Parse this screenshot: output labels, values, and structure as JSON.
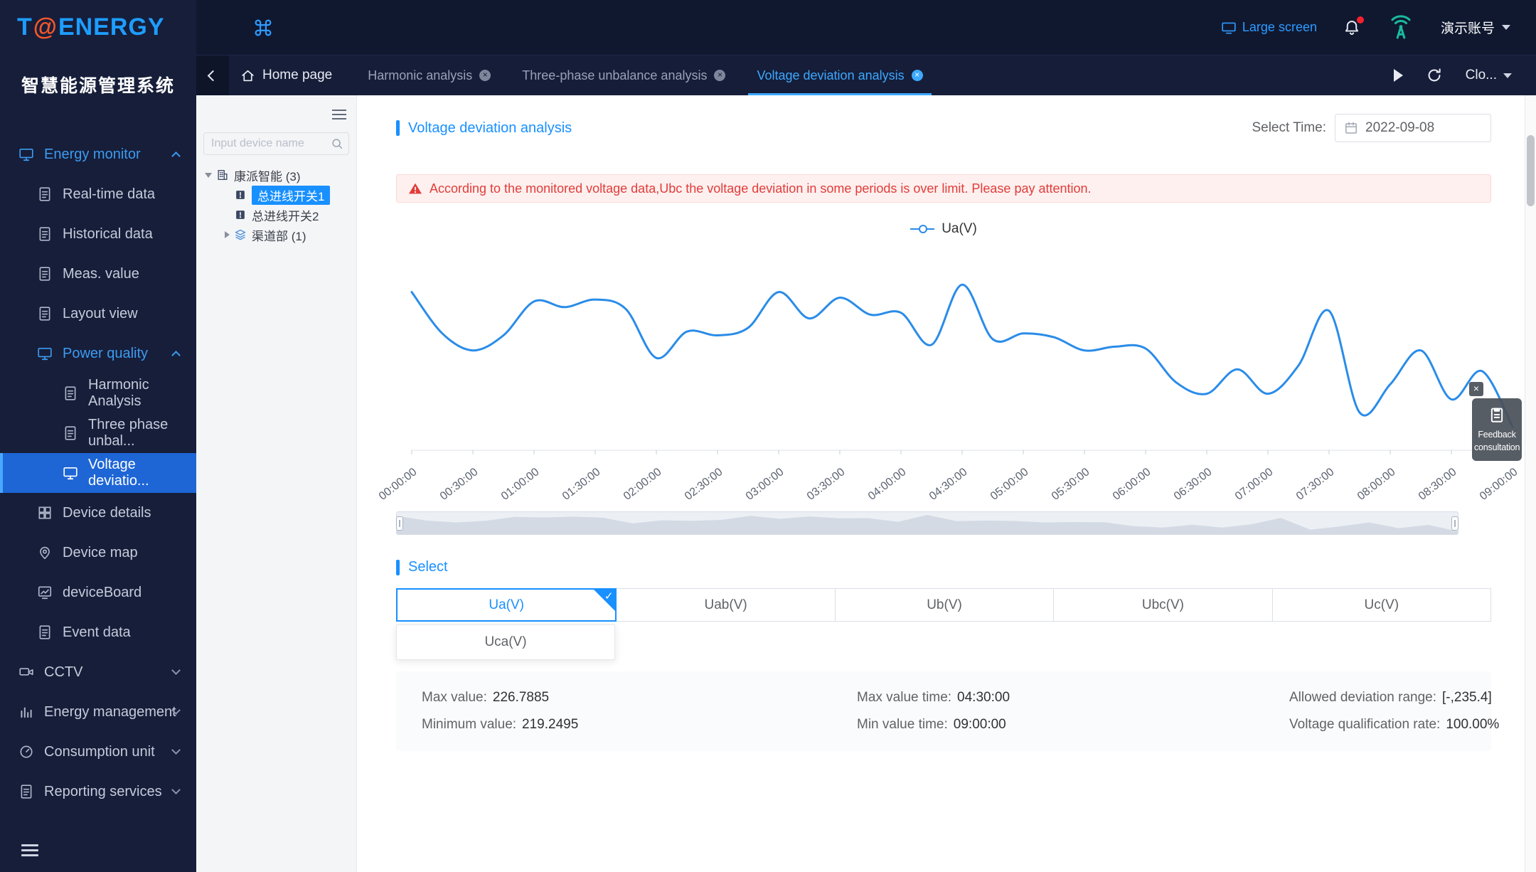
{
  "brand": {
    "logo_t": "T",
    "logo_at": "@",
    "logo_rest": "ENERGY",
    "system_title": "智慧能源管理系统"
  },
  "topbar": {
    "large_screen_label": "Large screen",
    "account_label": "演示账号"
  },
  "tabbar": {
    "home_label": "Home page",
    "tabs": [
      {
        "label": "Harmonic analysis",
        "active": false
      },
      {
        "label": "Three-phase unbalance analysis",
        "active": false
      },
      {
        "label": "Voltage deviation analysis",
        "active": true
      }
    ],
    "close_glyph": "×",
    "close_dropdown_label": "Clo..."
  },
  "sidebar": {
    "menu": [
      {
        "label": "Energy monitor",
        "level": 0,
        "icon": "monitor",
        "color": "blue",
        "chevron": "up"
      },
      {
        "label": "Real-time data",
        "level": 1,
        "icon": "doc"
      },
      {
        "label": "Historical data",
        "level": 1,
        "icon": "doc"
      },
      {
        "label": "Meas. value",
        "level": 1,
        "icon": "doc"
      },
      {
        "label": "Layout view",
        "level": 1,
        "icon": "doc"
      },
      {
        "label": "Power quality",
        "level": 1,
        "icon": "monitor",
        "color": "blue",
        "chevron": "up"
      },
      {
        "label": "Harmonic Analysis",
        "level": 2,
        "icon": "doc"
      },
      {
        "label": "Three phase unbal...",
        "level": 2,
        "icon": "doc"
      },
      {
        "label": "Voltage deviatio...",
        "level": 2,
        "icon": "monitor",
        "active": true
      },
      {
        "label": "Device details",
        "level": 1,
        "icon": "grid"
      },
      {
        "label": "Device map",
        "level": 1,
        "icon": "pin"
      },
      {
        "label": "deviceBoard",
        "level": 1,
        "icon": "board"
      },
      {
        "label": "Event data",
        "level": 1,
        "icon": "doc"
      },
      {
        "label": "CCTV",
        "level": 0,
        "icon": "camera",
        "chevron": "down"
      },
      {
        "label": "Energy management",
        "level": 0,
        "icon": "chart",
        "chevron": "down"
      },
      {
        "label": "Consumption unit",
        "level": 0,
        "icon": "gauge",
        "chevron": "down"
      },
      {
        "label": "Reporting services",
        "level": 0,
        "icon": "doc",
        "chevron": "down"
      }
    ]
  },
  "device_panel": {
    "search_placeholder": "Input device name",
    "tree": [
      {
        "label": "康派智能 (3)",
        "level": 0,
        "icon": "building",
        "caret": "exp"
      },
      {
        "label": "总进线开关1",
        "level": 1,
        "icon": "breaker",
        "selected": true
      },
      {
        "label": "总进线开关2",
        "level": 1,
        "icon": "breaker"
      },
      {
        "label": "渠道部 (1)",
        "level": 1,
        "icon": "layers",
        "caret": "col"
      }
    ]
  },
  "main": {
    "title": "Voltage deviation analysis",
    "select_time_label": "Select Time:",
    "date_value": "2022-09-08",
    "alert_text": "According to the monitored voltage data,Ubc the voltage deviation in some periods is over limit. Please pay attention.",
    "select_section_title": "Select",
    "options": [
      {
        "label": "Ua(V)",
        "selected": true
      },
      {
        "label": "Uab(V)"
      },
      {
        "label": "Ub(V)"
      },
      {
        "label": "Ubc(V)"
      },
      {
        "label": "Uc(V)"
      }
    ],
    "dropdown_option": "Uca(V)",
    "check_mark": "✓",
    "stats": [
      {
        "label": "Max value:",
        "value": "226.7885"
      },
      {
        "label": "Max value time:",
        "value": "04:30:00"
      },
      {
        "label": "Allowed deviation range:",
        "value": "[-,235.4]"
      },
      {
        "label": "Minimum value:",
        "value": "219.2495"
      },
      {
        "label": "Min value time:",
        "value": "09:00:00"
      },
      {
        "label": "Voltage qualification rate:",
        "value": "100.00%"
      }
    ]
  },
  "feedback": {
    "close": "×",
    "line1": "Feedback",
    "line2": "consultation"
  },
  "chart_data": {
    "type": "line",
    "title": "",
    "legend": [
      "Ua(V)"
    ],
    "legend_position": "top-center",
    "grid": false,
    "ylim": [
      218,
      228.5
    ],
    "x_tick_labels": [
      "00:00:00",
      "00:30:00",
      "01:00:00",
      "01:30:00",
      "02:00:00",
      "02:30:00",
      "03:00:00",
      "03:30:00",
      "04:00:00",
      "04:30:00",
      "05:00:00",
      "05:30:00",
      "06:00:00",
      "06:30:00",
      "07:00:00",
      "07:30:00",
      "08:00:00",
      "08:30:00",
      "09:00:00"
    ],
    "series": [
      {
        "name": "Ua(V)",
        "color": "#2a8ce8",
        "x": [
          "00:00:00",
          "00:15:00",
          "00:30:00",
          "00:45:00",
          "01:00:00",
          "01:15:00",
          "01:30:00",
          "01:45:00",
          "02:00:00",
          "02:15:00",
          "02:30:00",
          "02:45:00",
          "03:00:00",
          "03:15:00",
          "03:30:00",
          "03:45:00",
          "04:00:00",
          "04:15:00",
          "04:30:00",
          "04:45:00",
          "05:00:00",
          "05:15:00",
          "05:30:00",
          "05:45:00",
          "06:00:00",
          "06:15:00",
          "06:30:00",
          "06:45:00",
          "07:00:00",
          "07:15:00",
          "07:30:00",
          "07:45:00",
          "08:00:00",
          "08:15:00",
          "08:30:00",
          "08:45:00",
          "09:00:00"
        ],
        "values": [
          226.4,
          224.2,
          223.3,
          224.1,
          225.9,
          225.6,
          226.0,
          225.5,
          222.9,
          224.3,
          224.1,
          224.5,
          226.4,
          225.0,
          226.1,
          225.2,
          225.3,
          223.6,
          226.7885,
          223.9,
          224.2,
          224.0,
          223.3,
          223.5,
          223.4,
          221.6,
          221.0,
          222.3,
          221.0,
          222.5,
          225.4,
          220.0,
          221.5,
          223.3,
          220.7,
          222.2,
          219.2495
        ]
      }
    ]
  },
  "colors": {
    "accent_blue": "#1890ff",
    "sidebar_bg": "#161e3a",
    "topbar_bg": "#101830",
    "active_menu_bg": "#1e66d6",
    "chart_line": "#2a8ce8",
    "alert_text": "#e23c39",
    "alert_bg": "#fdf0ef",
    "teal_icon": "#1abc9c"
  }
}
